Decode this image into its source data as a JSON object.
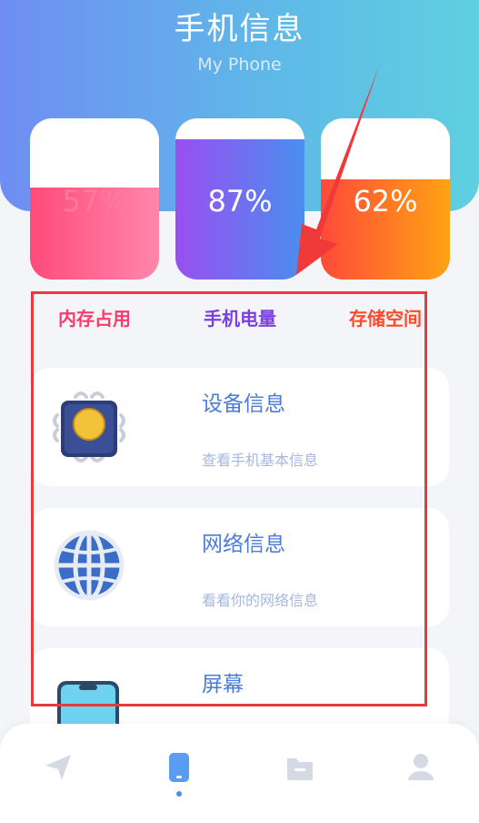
{
  "header": {
    "title": "手机信息",
    "subtitle": "My Phone"
  },
  "stats": [
    {
      "label": "内存占用",
      "value": "57%",
      "level": 0.57
    },
    {
      "label": "手机电量",
      "value": "87%",
      "level": 0.87
    },
    {
      "label": "存储空间",
      "value": "62%",
      "level": 0.62
    }
  ],
  "cards": [
    {
      "title": "设备信息",
      "desc": "查看手机基本信息",
      "icon": "cpu-chip-icon"
    },
    {
      "title": "网络信息",
      "desc": "看看你的网络信息",
      "icon": "globe-icon"
    },
    {
      "title": "屏幕",
      "icon": "phone-screen-icon"
    }
  ],
  "tabbar": {
    "items": [
      {
        "icon": "send-plane-icon",
        "active": false
      },
      {
        "icon": "phone-icon",
        "active": true
      },
      {
        "icon": "folder-icon",
        "active": false
      },
      {
        "icon": "person-icon",
        "active": false
      }
    ],
    "active_color": "#4a8ef0",
    "inactive_color": "#d5d9e3"
  },
  "annotation": {
    "box_color": "#e83a3a"
  }
}
